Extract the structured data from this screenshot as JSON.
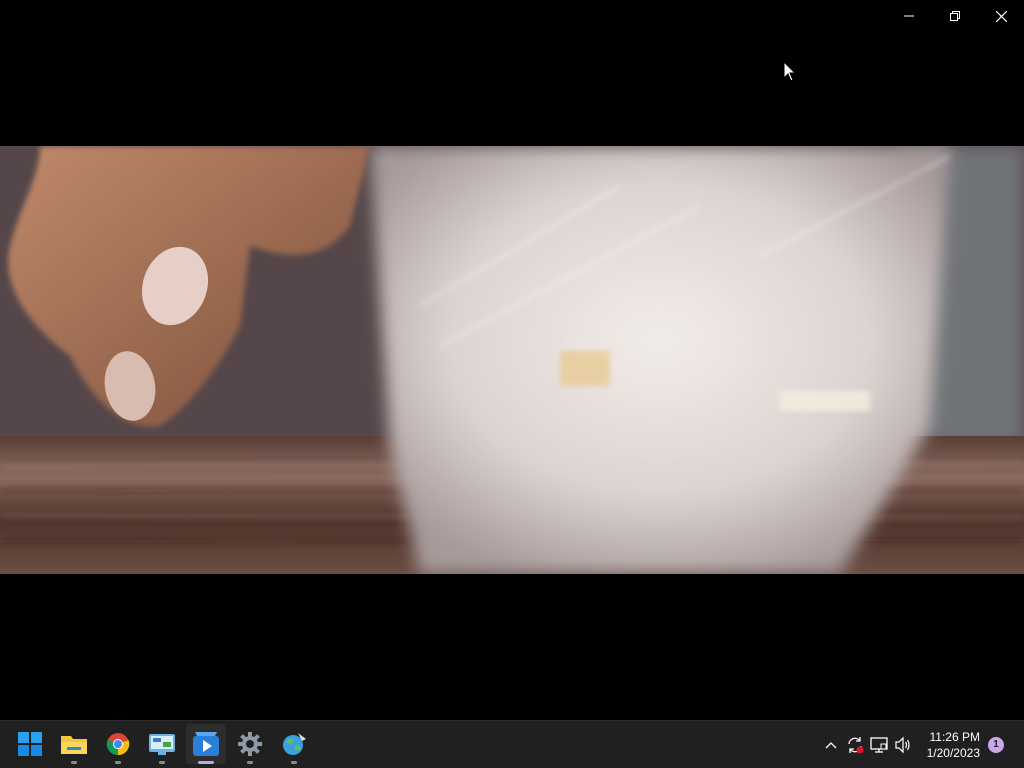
{
  "window": {
    "controls": {
      "minimize_icon": "minimize-icon",
      "restore_icon": "restore-icon",
      "close_icon": "close-icon"
    }
  },
  "video": {
    "description_icon": "video-frame"
  },
  "taskbar": {
    "apps": [
      {
        "name": "start",
        "icon": "windows-start-icon",
        "running": false,
        "active": false
      },
      {
        "name": "file-explorer",
        "icon": "folder-icon",
        "running": true,
        "active": false
      },
      {
        "name": "chrome",
        "icon": "chrome-icon",
        "running": true,
        "active": false
      },
      {
        "name": "control-panel",
        "icon": "control-panel-icon",
        "running": true,
        "active": false
      },
      {
        "name": "media-player",
        "icon": "media-player-icon",
        "running": true,
        "active": true
      },
      {
        "name": "settings",
        "icon": "gear-icon",
        "running": true,
        "active": false
      },
      {
        "name": "network-globe",
        "icon": "globe-icon",
        "running": true,
        "active": false
      }
    ],
    "tray": {
      "chevron_icon": "chevron-up-icon",
      "sync_icon": "sync-icon",
      "network_icon": "network-icon",
      "volume_icon": "volume-icon"
    },
    "clock": {
      "time": "11:26 PM",
      "date": "1/20/2023"
    },
    "notification_count": "1",
    "accent_color": "#c8a8e8"
  }
}
